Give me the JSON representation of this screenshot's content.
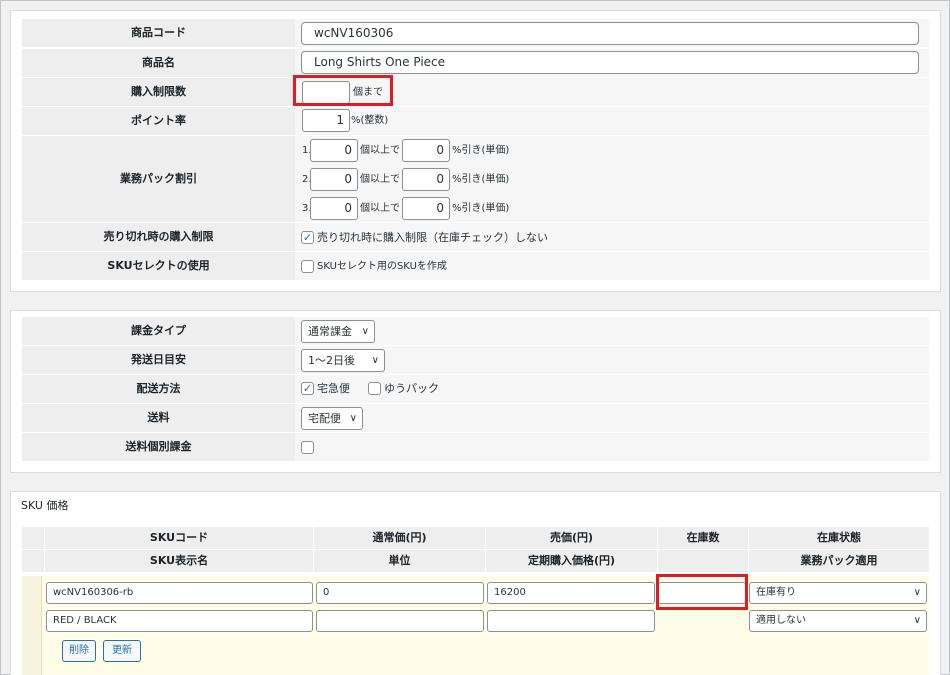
{
  "product": {
    "code_label": "商品コード",
    "code_value": "wcNV160306",
    "name_label": "商品名",
    "name_value": "Long Shirts One Piece",
    "limit_label": "購入制限数",
    "limit_value": "",
    "limit_suffix": "個まで",
    "point_label": "ポイント率",
    "point_value": "1",
    "point_suffix": "%(整数)",
    "bulk_label": "業務パック割引",
    "bulk_rows": [
      {
        "index": "1.",
        "qty": "0",
        "qty_suffix": "個以上で",
        "pct": "0",
        "pct_suffix": "%引き(単価)"
      },
      {
        "index": "2.",
        "qty": "0",
        "qty_suffix": "個以上で",
        "pct": "0",
        "pct_suffix": "%引き(単価)"
      },
      {
        "index": "3.",
        "qty": "0",
        "qty_suffix": "個以上で",
        "pct": "0",
        "pct_suffix": "%引き(単価)"
      }
    ],
    "soldout_label": "売り切れ時の購入制限",
    "soldout_checked": true,
    "soldout_text": "売り切れ時に購入制限（在庫チェック）しない",
    "skuselect_label": "SKUセレクトの使用",
    "skuselect_checked": false,
    "skuselect_text": "SKUセレクト用のSKUを作成"
  },
  "shipping": {
    "billing_label": "課金タイプ",
    "billing_value": "通常課金",
    "delivery_label": "発送日目安",
    "delivery_value": "1〜2日後",
    "method_label": "配送方法",
    "method_options": [
      {
        "label": "宅急便",
        "checked": true
      },
      {
        "label": "ゆうパック",
        "checked": false
      }
    ],
    "fee_label": "送料",
    "fee_value": "宅配便",
    "individual_label": "送料個別課金",
    "individual_checked": false
  },
  "sku": {
    "section_title": "SKU 価格",
    "headers_row1": [
      "SKUコード",
      "通常価(円)",
      "売価(円)",
      "在庫数",
      "在庫状態"
    ],
    "headers_row2": [
      "SKU表示名",
      "単位",
      "定期購入価格(円)",
      "",
      "業務パック適用"
    ],
    "item": {
      "code": "wcNV160306-rb",
      "normal_price": "0",
      "sale_price": "16200",
      "stock": "",
      "stock_status": "在庫有り",
      "display_name": "RED / BLACK",
      "unit": "",
      "subscription_price": "",
      "bulk_apply": "適用しない"
    },
    "delete_label": "削除",
    "update_label": "更新"
  },
  "colors": {
    "highlight": "#e01b24",
    "accent": "#2271b1",
    "row_bg": "#fffde7"
  }
}
